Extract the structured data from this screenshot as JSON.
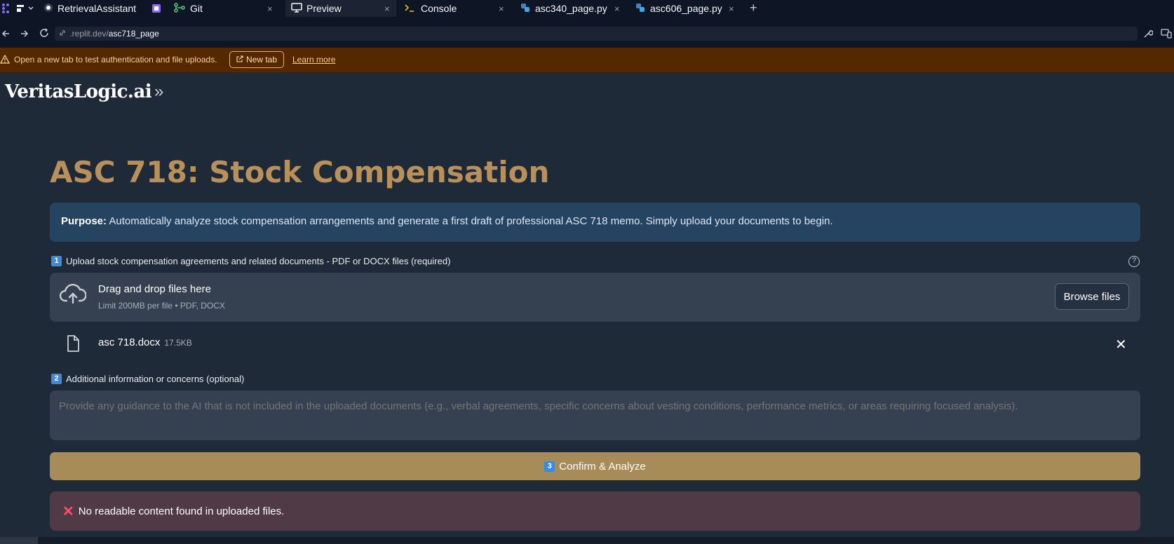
{
  "tabs": [
    {
      "label": "RetrievalAssistant",
      "icon": "replit-repl-icon"
    },
    {
      "label": "Git",
      "icon": "git-branch-icon",
      "close": "×"
    },
    {
      "label": "Preview",
      "icon": "monitor-icon",
      "close": "×",
      "active": true
    },
    {
      "label": "Console",
      "icon": "terminal-icon",
      "close": "×"
    },
    {
      "label": "asc340_page.py",
      "icon": "python-icon",
      "close": "×"
    },
    {
      "label": "asc606_page.py",
      "icon": "python-icon",
      "close": "×"
    }
  ],
  "new_tab_symbol": "+",
  "url": {
    "prefix": ".replit.dev/",
    "path": "asc718_page"
  },
  "banner": {
    "message": "Open a new tab to test authentication and file uploads.",
    "new_tab_label": "New tab",
    "learn_more_label": "Learn more"
  },
  "app": {
    "brand": "VeritasLogic.ai",
    "expand_symbol": "»",
    "menu_symbol": "⋮",
    "title": "ASC 718: Stock Compensation",
    "purpose_label": "Purpose:",
    "purpose_text": " Automatically analyze stock compensation arrangements and generate a first draft of professional ASC 718 memo. Simply upload your documents to begin.",
    "upload": {
      "step": "1",
      "label": "Upload stock compensation agreements and related documents - PDF or DOCX files (required)",
      "help_symbol": "?",
      "drop_title": "Drag and drop files here",
      "drop_sub": "Limit 200MB per file • PDF, DOCX",
      "browse_label": "Browse files"
    },
    "file": {
      "name": "asc 718.docx",
      "size": "17.5KB",
      "remove_symbol": "✕"
    },
    "additional": {
      "step": "2",
      "label": "Additional information or concerns (optional)",
      "placeholder": "Provide any guidance to the AI that is not included in the uploaded documents (e.g., verbal agreements, specific concerns about vesting conditions, performance metrics, or areas requiring focused analysis)."
    },
    "confirm": {
      "step": "3",
      "label": "Confirm & Analyze"
    },
    "error": {
      "symbol": "✕",
      "message": "No readable content found in uploaded files."
    }
  },
  "colors": {
    "accent_gold": "#b99059",
    "button_gold": "#a78c5a",
    "info_blue": "#254461",
    "error_bg": "#4f3a45",
    "banner_bg": "#552800"
  }
}
